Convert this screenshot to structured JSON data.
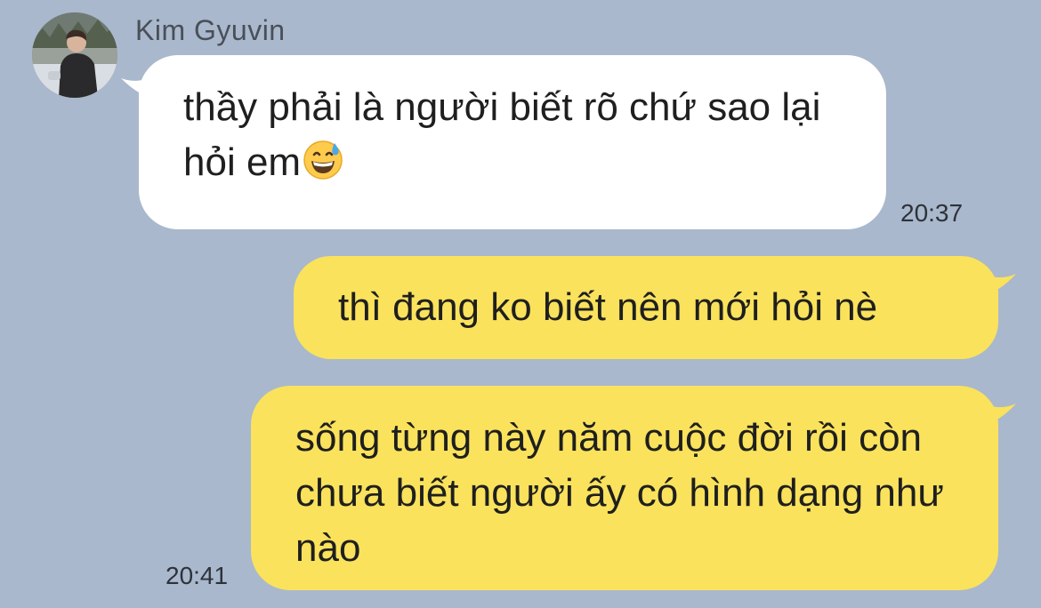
{
  "contact": {
    "name": "Kim Gyuvin",
    "avatar_icon": "profile-photo"
  },
  "messages": [
    {
      "direction": "incoming",
      "text": "thầy phải là người biết rõ chứ sao lại hỏi em",
      "emoji": "grinning-face-with-sweat",
      "time": "20:37"
    },
    {
      "direction": "outgoing",
      "text": "thì đang ko biết nên mới hỏi nè",
      "time": ""
    },
    {
      "direction": "outgoing",
      "text": "sống từng này năm cuộc đời rồi còn chưa biết người ấy có hình dạng như nào",
      "time": "20:41"
    }
  ],
  "colors": {
    "background": "#a9b8cc",
    "incoming_bubble": "#ffffff",
    "outgoing_bubble": "#fae25c"
  }
}
